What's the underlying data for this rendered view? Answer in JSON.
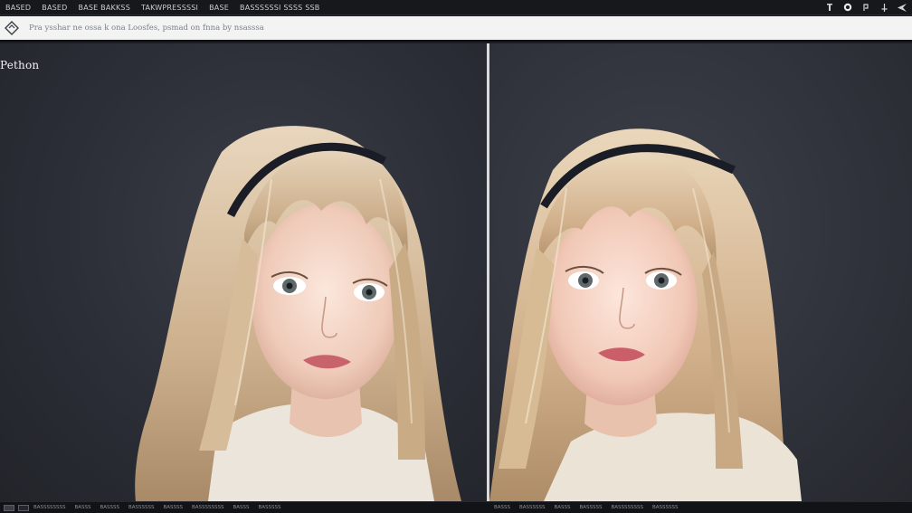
{
  "menubar": {
    "items": [
      {
        "label": "BASED"
      },
      {
        "label": "BASED"
      },
      {
        "label": "BASE BAKKSS"
      },
      {
        "label": "TAKWPRESSSSI"
      },
      {
        "label": "BASE"
      },
      {
        "label": "BASSSSSSI SSSS SSB"
      }
    ],
    "tray_icons": [
      "info-icon",
      "record-icon",
      "pen-icon",
      "pin-icon",
      "send-icon"
    ]
  },
  "prompt": {
    "placeholder": "Pra ysshar ne ossa k ona Loosfes, psmad on fnna by nsasssa"
  },
  "panel_left": {
    "title": "Pethon",
    "image": "Portrait of a young woman with long blonde hair and a black headband, soft studio lighting"
  },
  "panel_right": {
    "image": "Alternate render of the same portrait, slightly rotated and warmer tone"
  },
  "statusbar": {
    "left_items": [
      "BASSSSSSSS",
      "BASSS",
      "BASSSS",
      "BASSSSSS",
      "BASSSS",
      "BASSSSSSSS",
      "BASSS",
      "BASSSSS"
    ],
    "right_items": [
      "BASSS",
      "BASSSSSS",
      "BASSS",
      "BASSSSS",
      "BASSSSSSSS",
      "BASSSSSS"
    ]
  },
  "colors": {
    "background": "#2b2e36",
    "hair": "#d8c2a2",
    "skin": "#f3d7c6",
    "headband": "#1a1d26",
    "sweater": "#e9e2d8",
    "lips": "#c9636b"
  }
}
